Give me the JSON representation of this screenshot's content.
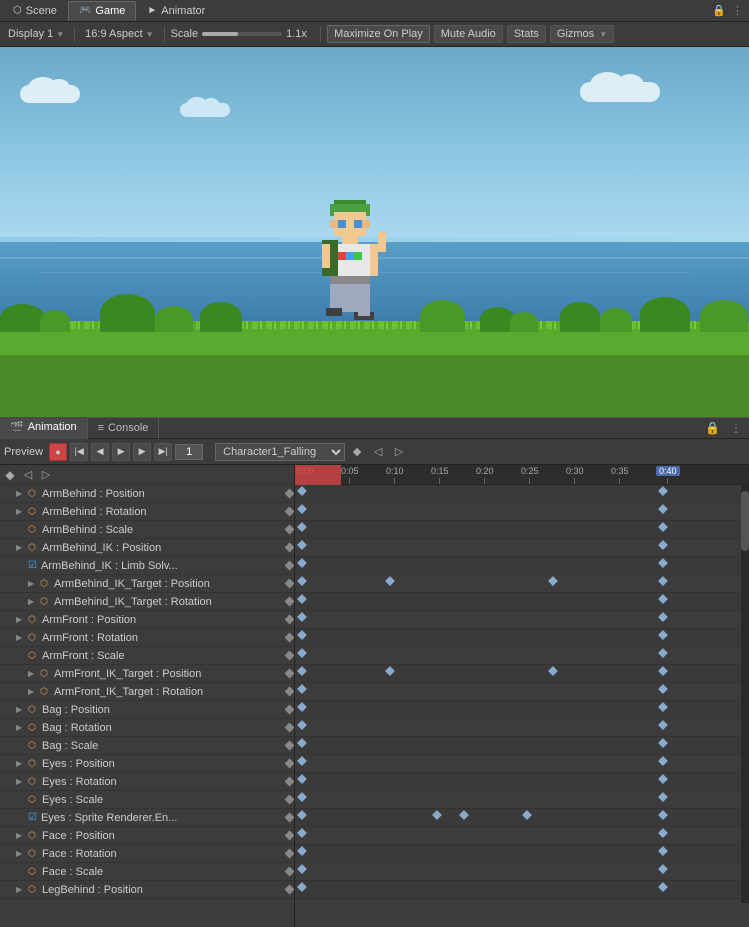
{
  "tabs": {
    "scene": {
      "label": "Scene",
      "icon": "⬡",
      "active": false
    },
    "game": {
      "label": "Game",
      "icon": "🎮",
      "active": true
    },
    "animator": {
      "label": "Animator",
      "icon": "►",
      "active": false
    }
  },
  "toolbar": {
    "display_label": "Display 1",
    "aspect_label": "16:9 Aspect",
    "scale_label": "Scale",
    "scale_value": "1.1x",
    "maximize_on_play": "Maximize On Play",
    "mute_audio": "Mute Audio",
    "stats": "Stats",
    "gizmos": "Gizmos"
  },
  "panel_tabs": {
    "animation": {
      "label": "Animation",
      "icon": "🎬"
    },
    "console": {
      "label": "Console",
      "icon": "≡"
    }
  },
  "anim_controls": {
    "frame_value": "1",
    "clip_name": "Character1_Falling",
    "record_btn": "●",
    "prev_keyframe": "◀",
    "prev_frame": "◁",
    "play": "▶",
    "next_frame": "▷",
    "next_keyframe": "▶▶"
  },
  "ruler": {
    "marks": [
      "0:00",
      "0:05",
      "0:10",
      "0:15",
      "0:20",
      "0:25",
      "0:30",
      "0:35",
      "0:40"
    ]
  },
  "properties": [
    {
      "id": "armBehindPos",
      "indent": 1,
      "group": true,
      "expanded": true,
      "icon": "⬡",
      "name": "ArmBehind : Position",
      "has_key": true,
      "track_keys": [
        0
      ]
    },
    {
      "id": "armBehindRot",
      "indent": 1,
      "group": true,
      "expanded": true,
      "icon": "⬡",
      "name": "ArmBehind : Rotation",
      "has_key": true,
      "track_keys": [
        0
      ]
    },
    {
      "id": "armBehindScl",
      "indent": 1,
      "group": false,
      "expanded": false,
      "icon": "⬡",
      "name": "ArmBehind : Scale",
      "has_key": true,
      "track_keys": [
        0
      ]
    },
    {
      "id": "armBehindIKPos",
      "indent": 1,
      "group": true,
      "expanded": true,
      "icon": "⬡",
      "name": "ArmBehind_IK : Position",
      "has_key": true,
      "track_keys": [
        0
      ]
    },
    {
      "id": "armBehindIKLimb",
      "indent": 1,
      "group": false,
      "expanded": false,
      "icon": "☑",
      "name": "ArmBehind_IK : Limb Solv...",
      "has_key": true,
      "track_keys": [
        0
      ],
      "checkbox": true
    },
    {
      "id": "armBehindIKTgtPos",
      "indent": 2,
      "group": true,
      "expanded": true,
      "icon": "⬡",
      "name": "ArmBehind_IK_Target : Position",
      "has_key": true,
      "track_keys": [
        2,
        6
      ]
    },
    {
      "id": "armBehindIKTgtRot",
      "indent": 2,
      "group": true,
      "expanded": true,
      "icon": "⬡",
      "name": "ArmBehind_IK_Target : Rotation",
      "has_key": true,
      "track_keys": [
        0
      ]
    },
    {
      "id": "armFrontPos",
      "indent": 1,
      "group": true,
      "expanded": true,
      "icon": "⬡",
      "name": "ArmFront : Position",
      "has_key": true,
      "track_keys": [
        0
      ]
    },
    {
      "id": "armFrontRot",
      "indent": 1,
      "group": true,
      "expanded": true,
      "icon": "⬡",
      "name": "ArmFront : Rotation",
      "has_key": true,
      "track_keys": [
        0
      ]
    },
    {
      "id": "armFrontScl",
      "indent": 1,
      "group": false,
      "expanded": false,
      "icon": "⬡",
      "name": "ArmFront : Scale",
      "has_key": true,
      "track_keys": [
        0
      ]
    },
    {
      "id": "armFrontIKTgtPos",
      "indent": 2,
      "group": true,
      "expanded": true,
      "icon": "⬡",
      "name": "ArmFront_IK_Target : Position",
      "has_key": true,
      "track_keys": [
        2,
        6
      ]
    },
    {
      "id": "armFrontIKTgtRot",
      "indent": 2,
      "group": true,
      "expanded": true,
      "icon": "⬡",
      "name": "ArmFront_IK_Target : Rotation",
      "has_key": true,
      "track_keys": [
        0
      ]
    },
    {
      "id": "bagPos",
      "indent": 1,
      "group": true,
      "expanded": true,
      "icon": "⬡",
      "name": "Bag : Position",
      "has_key": true,
      "track_keys": [
        0
      ]
    },
    {
      "id": "bagRot",
      "indent": 1,
      "group": true,
      "expanded": true,
      "icon": "⬡",
      "name": "Bag : Rotation",
      "has_key": true,
      "track_keys": [
        0
      ]
    },
    {
      "id": "bagScl",
      "indent": 1,
      "group": false,
      "expanded": false,
      "icon": "⬡",
      "name": "Bag : Scale",
      "has_key": true,
      "track_keys": [
        0
      ]
    },
    {
      "id": "eyesPos",
      "indent": 1,
      "group": true,
      "expanded": true,
      "icon": "⬡",
      "name": "Eyes : Position",
      "has_key": true,
      "track_keys": [
        0
      ]
    },
    {
      "id": "eyesRot",
      "indent": 1,
      "group": true,
      "expanded": true,
      "icon": "⬡",
      "name": "Eyes : Rotation",
      "has_key": true,
      "track_keys": [
        0
      ]
    },
    {
      "id": "eyesScl",
      "indent": 1,
      "group": false,
      "expanded": false,
      "icon": "⬡",
      "name": "Eyes : Scale",
      "has_key": true,
      "track_keys": [
        0
      ]
    },
    {
      "id": "eyesSpriteRen",
      "indent": 1,
      "group": false,
      "expanded": false,
      "icon": "☑",
      "name": "Eyes : Sprite Renderer.En...",
      "has_key": true,
      "track_keys": [
        3,
        4,
        5
      ],
      "checkbox": true
    },
    {
      "id": "facePos",
      "indent": 1,
      "group": true,
      "expanded": true,
      "icon": "⬡",
      "name": "Face : Position",
      "has_key": true,
      "track_keys": [
        0
      ]
    },
    {
      "id": "faceRot",
      "indent": 1,
      "group": true,
      "expanded": true,
      "icon": "⬡",
      "name": "Face : Rotation",
      "has_key": true,
      "track_keys": [
        0
      ]
    },
    {
      "id": "faceScl",
      "indent": 1,
      "group": false,
      "expanded": false,
      "icon": "⬡",
      "name": "Face : Scale",
      "has_key": true,
      "track_keys": [
        0
      ]
    },
    {
      "id": "legBehindPos",
      "indent": 1,
      "group": true,
      "expanded": true,
      "icon": "⬡",
      "name": "LegBehind : Position",
      "has_key": true,
      "track_keys": [
        0
      ]
    }
  ],
  "colors": {
    "bg": "#3c3c3c",
    "tab_active": "#4a4a4a",
    "border": "#222",
    "accent_blue": "#8ac",
    "record_red": "#c44",
    "sky_top": "#7bb8d4",
    "sky_bottom": "#a8d4e8",
    "ocean": "#4a8cb8",
    "grass": "#5a9e2f",
    "grass_top": "#6ab83a"
  }
}
